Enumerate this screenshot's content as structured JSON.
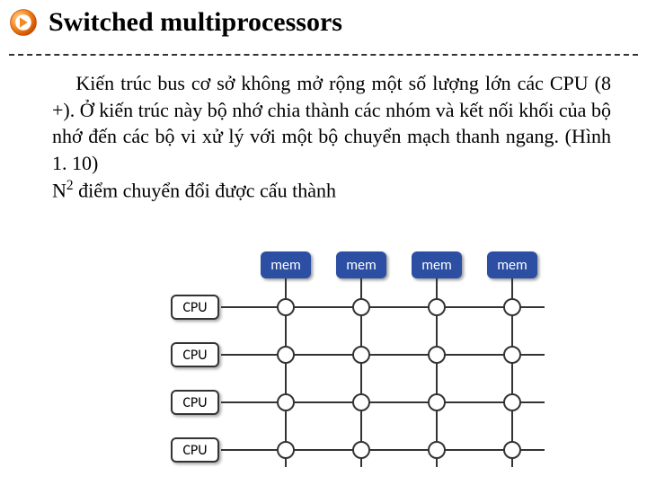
{
  "slide": {
    "title": "Switched multiprocessors",
    "body_parts": {
      "p1": "Kiến trúc bus cơ sở không mở rộng một số lượng lớn các CPU (8 +). Ở kiến trúc này bộ nhớ chia thành các nhóm và kết nối khối của bộ nhớ đến các bộ vi xử lý với một bộ chuyển mạch thanh ngang. (Hình 1. 10)",
      "p2_pre": "N",
      "p2_sup": "2",
      "p2_post": "  điểm chuyển đổi được cấu thành"
    }
  },
  "diagram": {
    "mem_label": "mem",
    "cpu_label": "CPU",
    "rows": 4,
    "cols": 4
  },
  "colors": {
    "mem_fill": "#2c4fa3",
    "accent_orange": "#f26a1b"
  }
}
